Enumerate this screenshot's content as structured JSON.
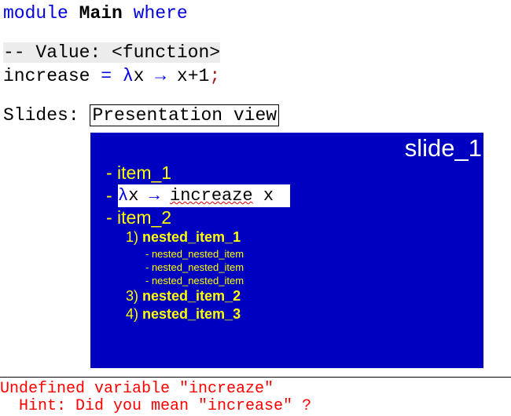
{
  "editor": {
    "line1": {
      "kw1": "module",
      "name": "Main",
      "kw2": "where"
    },
    "comment": "-- Value: <function>",
    "def": {
      "name": "increase",
      "eq": "=",
      "lambda": "λ",
      "arg": "x",
      "arrow": "→",
      "body": "x+1",
      "semi": ";"
    },
    "slides_label": "Slides:",
    "presentation_button": "Presentation view"
  },
  "slide": {
    "title": "slide_1",
    "item1": "- item_1",
    "code": {
      "dash": "- ",
      "lambda": "λ",
      "arg": "x ",
      "arrow": "→",
      "fn": "increaze",
      "tail": " x"
    },
    "item2": "- item_2",
    "nested": [
      {
        "num": "1) ",
        "label": "nested_item_1"
      },
      {
        "num": "3) ",
        "label": "nested_item_2"
      },
      {
        "num": "4) ",
        "label": "nested_item_3"
      }
    ],
    "nested_nested": [
      "- nested_nested_item",
      "- nested_nested_item",
      "- nested_nested_item"
    ]
  },
  "error": {
    "message": "Undefined variable \"increaze\"",
    "hint": "  Hint: Did you mean \"increase\" ?"
  },
  "colors": {
    "keyword": "#0000e0",
    "slide_bg": "#0000c0",
    "slide_text": "#ffff00",
    "error": "#ff0000"
  }
}
